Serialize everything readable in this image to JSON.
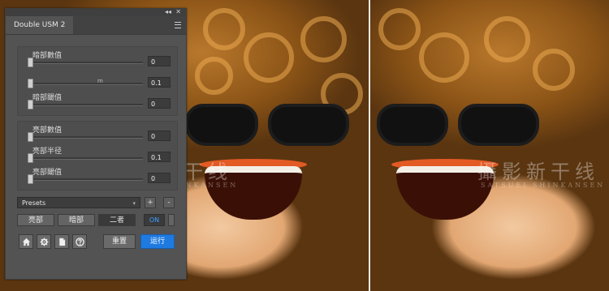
{
  "panel": {
    "title": "Double USM 2",
    "collapse_glyph": "◂◂",
    "close_glyph": "✕"
  },
  "shadow_group": {
    "sliders": [
      {
        "label": "暗部數值",
        "value": "0",
        "unit": ""
      },
      {
        "label": "",
        "value": "0.1",
        "unit": "m"
      },
      {
        "label": "暗部閾值",
        "value": "0",
        "unit": ""
      }
    ]
  },
  "highlight_group": {
    "sliders": [
      {
        "label": "亮部數值",
        "value": "0"
      },
      {
        "label": "亮部半径",
        "value": "0.1"
      },
      {
        "label": "亮部閾值",
        "value": "0"
      }
    ]
  },
  "presets": {
    "selected": "Presets",
    "add": "+",
    "remove": "-"
  },
  "modes": {
    "shadow": "亮部",
    "highlight": "暗部",
    "both": "二者",
    "toggle": "ON"
  },
  "actions": {
    "reset": "重置",
    "run": "运行"
  },
  "icons": [
    "home-icon",
    "gear-icon",
    "document-icon",
    "help-icon"
  ],
  "watermark": {
    "main": "攝影新干线",
    "sub": "SATSUEI SHINKANSEN"
  },
  "colors": {
    "panel": "#535353",
    "accent": "#1f7ae0",
    "on_text": "#3aa0ff"
  }
}
